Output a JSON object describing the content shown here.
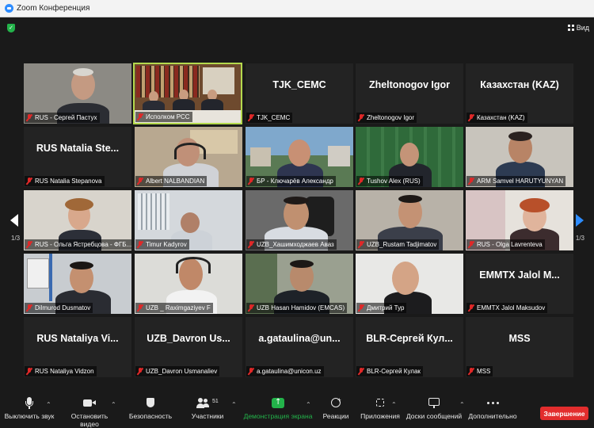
{
  "window": {
    "title": "Zoom Конференция"
  },
  "topbar": {
    "view_label": "Вид"
  },
  "pagination": {
    "left": "1/3",
    "right": "1/3"
  },
  "tiles": [
    {
      "big": "",
      "label": "RUS - Сергей Пастух"
    },
    {
      "big": "",
      "label": "Исполком РСС"
    },
    {
      "big": "TJK_CEMC",
      "label": "TJK_CEMC"
    },
    {
      "big": "Zheltonogov Igor",
      "label": "Zheltonogov Igor"
    },
    {
      "big": "Казахстан (KAZ)",
      "label": "Казахстан (KAZ)"
    },
    {
      "big": "RUS Natalia Ste...",
      "label": "RUS Natalia Stepanova"
    },
    {
      "big": "",
      "label": "Albert NALBANDIAN"
    },
    {
      "big": "",
      "label": "БР - Ключарёв Александр"
    },
    {
      "big": "",
      "label": "Tushov Alex (RUS)"
    },
    {
      "big": "",
      "label": "ARM Samvel HARUTYUNYAN"
    },
    {
      "big": "",
      "label": "RUS - Ольга Ястребцова - ФГБ..."
    },
    {
      "big": "",
      "label": "Timur Kadyrov"
    },
    {
      "big": "",
      "label": "UZB_Хашимходжаев Аваз"
    },
    {
      "big": "",
      "label": "UZB_Rustam Tadjimatov"
    },
    {
      "big": "",
      "label": "RUS - Olga Lavrenteva"
    },
    {
      "big": "",
      "label": "Dilmurod Dusmatov"
    },
    {
      "big": "",
      "label": "UZB _ Raximgaziyev F"
    },
    {
      "big": "",
      "label": "UZB Hasan Hamidov (EMCAS)"
    },
    {
      "big": "",
      "label": "Дмитрий Тур"
    },
    {
      "big": "EMMTX Jalol M...",
      "label": "EMMTX Jalol Maksudov"
    },
    {
      "big": "RUS Nataliya Vi...",
      "label": "RUS Nataliya Vidzon"
    },
    {
      "big": "UZB_Davron Us...",
      "label": "UZB_Davron Usmanaliev"
    },
    {
      "big": "a.gataulina@un...",
      "label": "a.gataulina@unicon.uz"
    },
    {
      "big": "BLR-Сергей Кул...",
      "label": "BLR-Сергей Кулак"
    },
    {
      "big": "MSS",
      "label": "MSS"
    }
  ],
  "toolbar": {
    "mute": "Выключить звук",
    "video": "Остановить видео",
    "security": "Безопасность",
    "participants": "Участники",
    "participants_count": "51",
    "share": "Демонстрация экрана",
    "reactions": "Реакции",
    "apps": "Приложения",
    "whiteboard": "Доски сообщений",
    "more": "Дополнительно",
    "end": "Завершение"
  },
  "colors": {
    "accent": "#2d8cff",
    "end": "#e22d2d",
    "active_speaker": "#b4d94d",
    "share": "#23b34a"
  }
}
